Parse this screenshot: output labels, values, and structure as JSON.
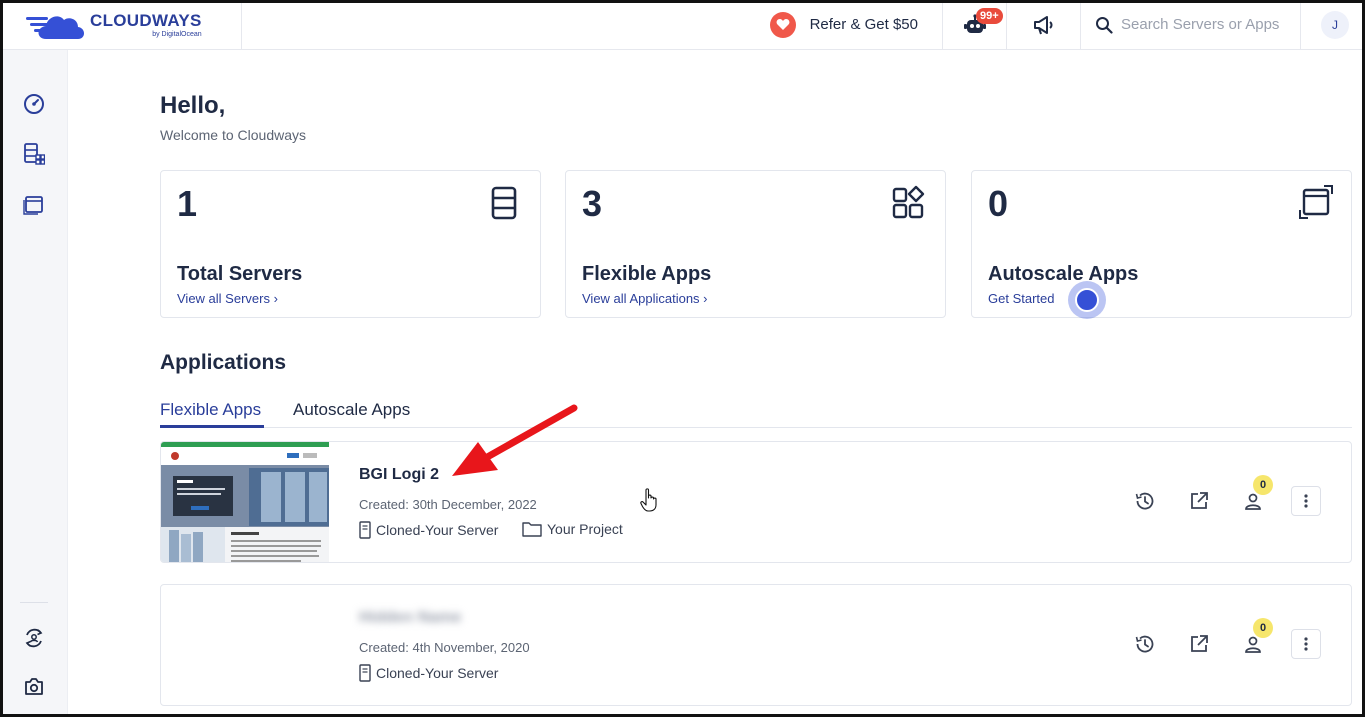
{
  "brand": {
    "name": "CLOUDWAYS",
    "sub": "by DigitalOcean"
  },
  "header": {
    "refer_label": "Refer & Get $50",
    "notifications_badge": "99+",
    "search_placeholder": "Search Servers or Apps",
    "avatar_initial": "J"
  },
  "sidebar": {
    "icons": [
      "dashboard-icon",
      "servers-apps-icon",
      "applications-icon",
      "sync-user-icon",
      "settings-icon"
    ]
  },
  "greeting": {
    "title": "Hello,",
    "subtitle": "Welcome to Cloudways"
  },
  "stats": [
    {
      "count": "1",
      "title": "Total Servers",
      "link": "View all Servers ›",
      "icon": "server-icon"
    },
    {
      "count": "3",
      "title": "Flexible Apps",
      "link": "View all Applications ›",
      "icon": "apps-grid-icon"
    },
    {
      "count": "0",
      "title": "Autoscale Apps",
      "link": "Get Started",
      "icon": "autoscale-icon"
    }
  ],
  "applications": {
    "heading": "Applications",
    "tabs": [
      {
        "label": "Flexible Apps",
        "active": true
      },
      {
        "label": "Autoscale Apps",
        "active": false
      }
    ],
    "items": [
      {
        "name": "BGI Logi 2",
        "created": "Created: 30th December, 2022",
        "server": "Cloned-Your Server",
        "project": "Your Project",
        "collaborators": "0"
      },
      {
        "name": "Hidden Name",
        "created": "Created: 4th November, 2020",
        "server": "Cloned-Your Server",
        "collaborators": "0"
      }
    ]
  },
  "colors": {
    "accent": "#2a3e9a",
    "heart": "#f0584a",
    "badge": "#e94b3c",
    "user_badge": "#f6e66c",
    "arrow": "#e8161b"
  }
}
